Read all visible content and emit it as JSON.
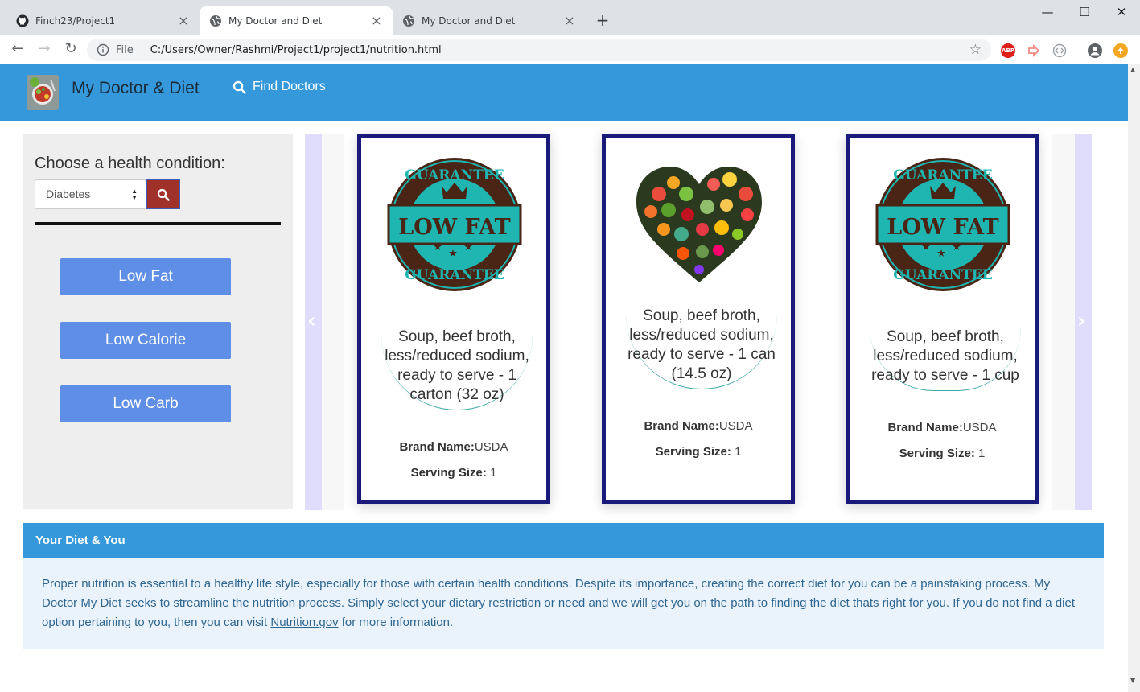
{
  "browser": {
    "tabs": [
      {
        "title": "Finch23/Project1",
        "icon": "github-icon"
      },
      {
        "title": "My Doctor and Diet",
        "icon": "globe-icon"
      },
      {
        "title": "My Doctor and Diet",
        "icon": "globe-icon"
      }
    ],
    "active_tab": 1,
    "new_tab": "+",
    "window_controls": {
      "minimize": "—",
      "maximize": "☐",
      "close": "✕"
    },
    "nav": {
      "back": "←",
      "forward": "→",
      "reload": "↻"
    },
    "address": {
      "scheme": "File",
      "url": "C:/Users/Owner/Rashmi/Project1/project1/nutrition.html"
    },
    "extensions": [
      {
        "name": "abp-icon",
        "label": "ABP",
        "color": "#e0211b"
      },
      {
        "name": "extension-arrow-icon",
        "label": "",
        "color": "#f28b82"
      },
      {
        "name": "extension-code-icon",
        "label": "",
        "color": "#9aa0a6"
      }
    ]
  },
  "navbar": {
    "brand": "My Doctor & Diet",
    "link": "Find Doctors",
    "color": "#3498db"
  },
  "sidebar": {
    "heading": "Choose a health condition:",
    "select_value": "Diabetes",
    "select_arrows": "▲▼",
    "buttons": [
      "Low Fat",
      "Low Calorie",
      "Low Carb"
    ]
  },
  "carousel": {
    "prev": "‹",
    "next": "›",
    "cards": [
      {
        "image": "low-fat-guarantee-badge",
        "badge_top": "GUARANTEE",
        "badge_middle": "LOW FAT",
        "badge_bottom": "GUARANTEE",
        "description": "Soup, beef broth, less/reduced sodium, ready to serve - 1 carton (32 oz)",
        "brand_label": "Brand Name:",
        "brand_value": "USDA",
        "serving_label": "Serving Size:",
        "serving_value": "1"
      },
      {
        "image": "fruit-heart",
        "description": "Soup, beef broth, less/reduced sodium, ready to serve - 1 can (14.5 oz)",
        "brand_label": "Brand Name:",
        "brand_value": "USDA",
        "serving_label": "Serving Size:",
        "serving_value": "1"
      },
      {
        "image": "low-fat-guarantee-badge",
        "badge_top": "GUARANTEE",
        "badge_middle": "LOW FAT",
        "badge_bottom": "GUARANTEE",
        "description": "Soup, beef broth, less/reduced sodium, ready to serve - 1 cup",
        "brand_label": "Brand Name:",
        "brand_value": "USDA",
        "serving_label": "Serving Size:",
        "serving_value": "1"
      }
    ]
  },
  "diet_panel": {
    "title": "Your Diet & You",
    "body_before_link": "Proper nutrition is essential to a healthy life style, especially for those with certain health conditions. Despite its importance, creating the correct diet for you can be a painstaking process. My Doctor My Diet seeks to streamline the nutrition process. Simply select your dietary restriction or need and we will get you on the path to finding the diet thats right for you. If you do not find a diet option pertaining to you, then you can visit ",
    "link_text": "Nutrition.gov",
    "body_after_link": " for more information."
  }
}
